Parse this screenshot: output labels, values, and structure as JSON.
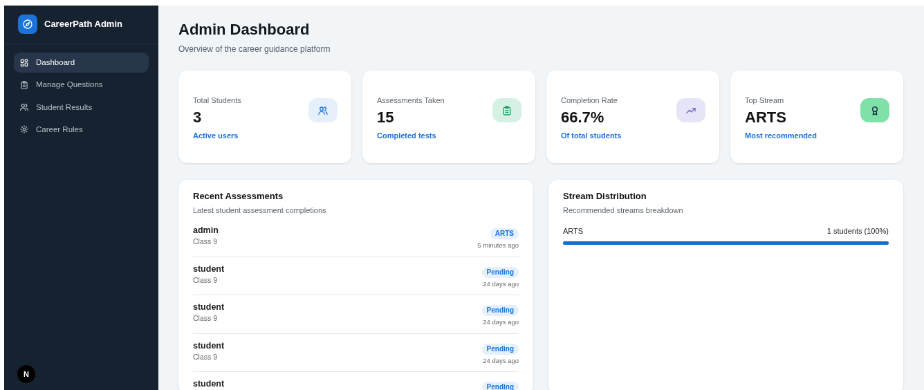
{
  "sidebar": {
    "brand": "CareerPath Admin",
    "items": [
      {
        "label": "Dashboard",
        "selected": true
      },
      {
        "label": "Manage Questions",
        "selected": false
      },
      {
        "label": "Student Results",
        "selected": false
      },
      {
        "label": "Career Rules",
        "selected": false
      }
    ],
    "footer_badge": "N"
  },
  "header": {
    "title": "Admin Dashboard",
    "subtitle": "Overview of the career guidance platform"
  },
  "stats": [
    {
      "label": "Total Students",
      "value": "3",
      "note": "Active users"
    },
    {
      "label": "Assessments Taken",
      "value": "15",
      "note": "Completed tests"
    },
    {
      "label": "Completion Rate",
      "value": "66.7%",
      "note": "Of total students"
    },
    {
      "label": "Top Stream",
      "value": "ARTS",
      "note": "Most recommended"
    }
  ],
  "recent": {
    "title": "Recent Assessments",
    "subtitle": "Latest student assessment completions",
    "rows": [
      {
        "name": "admin",
        "class": "Class 9",
        "badge": "ARTS",
        "time": "5 minutes ago"
      },
      {
        "name": "student",
        "class": "Class 9",
        "badge": "Pending",
        "time": "24 days ago"
      },
      {
        "name": "student",
        "class": "Class 9",
        "badge": "Pending",
        "time": "24 days ago"
      },
      {
        "name": "student",
        "class": "Class 9",
        "badge": "Pending",
        "time": "24 days ago"
      },
      {
        "name": "student",
        "badge": "Pending"
      }
    ]
  },
  "distribution": {
    "title": "Stream Distribution",
    "subtitle": "Recommended streams breakdown",
    "streams": [
      {
        "name": "ARTS",
        "count": "1 students (100%)",
        "level": 1
      }
    ]
  }
}
